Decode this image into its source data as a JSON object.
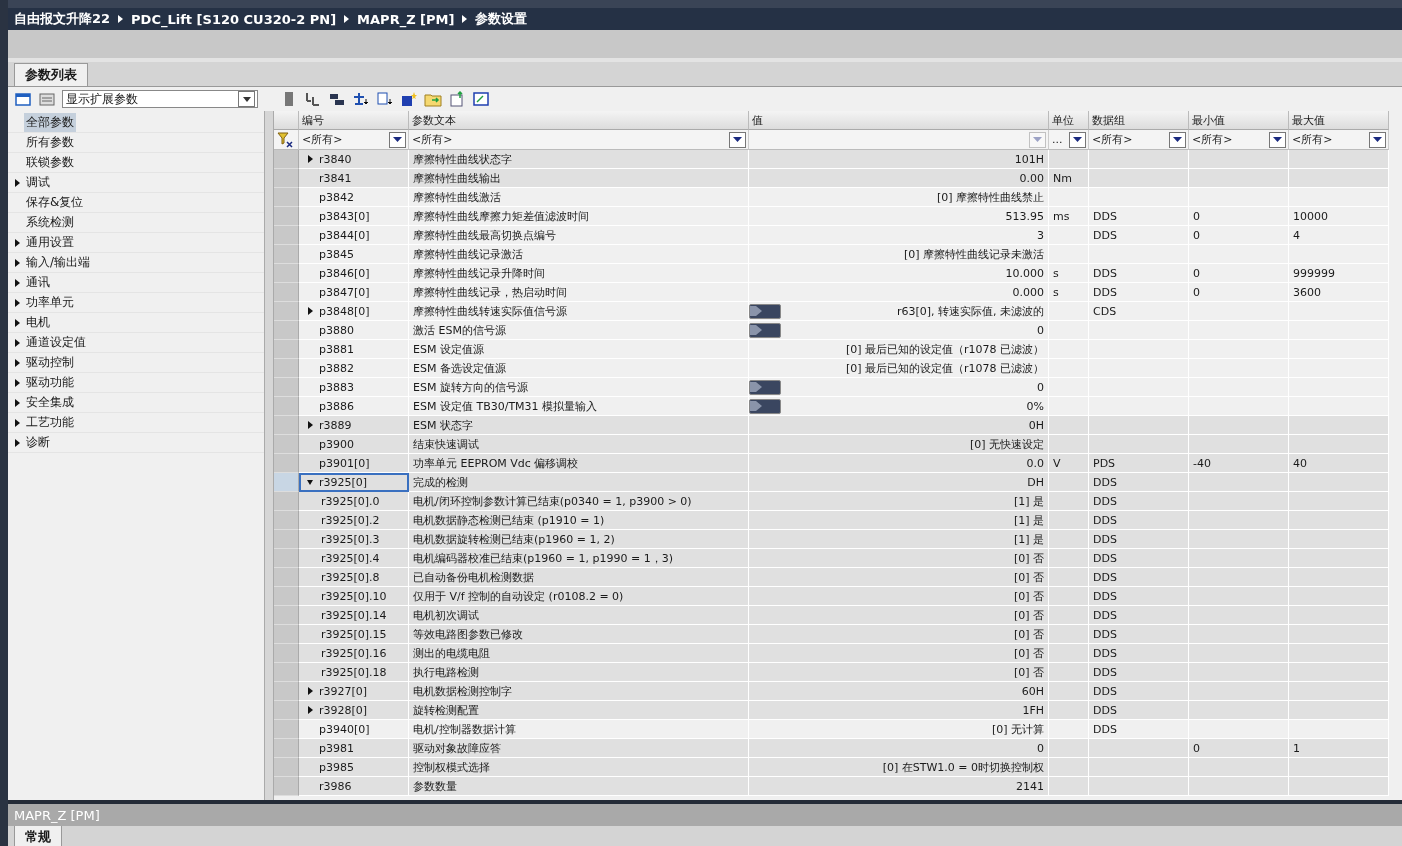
{
  "breadcrumb": [
    "自由报文升降22",
    "PDC_Lift [S120 CU320-2 PN]",
    "MAPR_Z [PM]",
    "参数设置"
  ],
  "tabs": [
    {
      "label": "参数列表",
      "selected": true
    }
  ],
  "view_select": {
    "value": "显示扩展参数"
  },
  "sidebar": {
    "items": [
      {
        "label": "全部参数",
        "selected": true,
        "expandable": false
      },
      {
        "label": "所有参数",
        "selected": false,
        "expandable": false
      },
      {
        "label": "联锁参数",
        "selected": false,
        "expandable": false
      },
      {
        "label": "调试",
        "selected": false,
        "expandable": true
      },
      {
        "label": "保存&复位",
        "selected": false,
        "expandable": false
      },
      {
        "label": "系统检测",
        "selected": false,
        "expandable": false
      },
      {
        "label": "通用设置",
        "selected": false,
        "expandable": true
      },
      {
        "label": "输入/输出端",
        "selected": false,
        "expandable": true
      },
      {
        "label": "通讯",
        "selected": false,
        "expandable": true
      },
      {
        "label": "功率单元",
        "selected": false,
        "expandable": true
      },
      {
        "label": "电机",
        "selected": false,
        "expandable": true
      },
      {
        "label": "通道设定值",
        "selected": false,
        "expandable": true
      },
      {
        "label": "驱动控制",
        "selected": false,
        "expandable": true
      },
      {
        "label": "驱动功能",
        "selected": false,
        "expandable": true
      },
      {
        "label": "安全集成",
        "selected": false,
        "expandable": true
      },
      {
        "label": "工艺功能",
        "selected": false,
        "expandable": true
      },
      {
        "label": "诊断",
        "selected": false,
        "expandable": true
      }
    ]
  },
  "table": {
    "columns": [
      "编号",
      "参数文本",
      "值",
      "单位",
      "数据组",
      "最小值",
      "最大值"
    ],
    "filters": [
      {
        "text": "<所有>",
        "disabled": false
      },
      {
        "text": "<所有>",
        "disabled": false
      },
      {
        "disabled": true
      },
      {
        "text": "...",
        "disabled": false
      },
      {
        "text": "<所有>",
        "disabled": false
      },
      {
        "text": "<所有>",
        "disabled": false
      },
      {
        "text": "<所有>",
        "disabled": false
      }
    ],
    "rows": [
      {
        "id": "r3840",
        "text": "摩擦特性曲线状态字",
        "value": "101H",
        "expandable": true,
        "expanded": false,
        "bico": false,
        "editable": false,
        "selected": false
      },
      {
        "id": "r3841",
        "text": "摩擦特性曲线输出",
        "value": "0.00",
        "unit": "Nm",
        "expandable": false,
        "expanded": false,
        "bico": false,
        "editable": false,
        "selected": false
      },
      {
        "id": "p3842",
        "text": "摩擦特性曲线激活",
        "value": "[0] 摩擦特性曲线禁止",
        "expandable": false,
        "expanded": false,
        "bico": false,
        "editable": true,
        "selected": false
      },
      {
        "id": "p3843[0]",
        "text": "摩擦特性曲线摩擦力矩差值滤波时间",
        "value": "513.95",
        "unit": "ms",
        "group": "DDS",
        "min": "0",
        "max": "10000",
        "expandable": false,
        "expanded": false,
        "bico": false,
        "editable": true,
        "selected": false
      },
      {
        "id": "p3844[0]",
        "text": "摩擦特性曲线最高切换点编号",
        "value": "3",
        "group": "DDS",
        "min": "0",
        "max": "4",
        "expandable": false,
        "expanded": false,
        "bico": false,
        "editable": true,
        "selected": false
      },
      {
        "id": "p3845",
        "text": "摩擦特性曲线记录激活",
        "value": "[0] 摩擦特性曲线记录未激活",
        "expandable": false,
        "expanded": false,
        "bico": false,
        "editable": true,
        "selected": false
      },
      {
        "id": "p3846[0]",
        "text": "摩擦特性曲线记录升降时间",
        "value": "10.000",
        "unit": "s",
        "group": "DDS",
        "min": "0",
        "max": "999999",
        "expandable": false,
        "expanded": false,
        "bico": false,
        "editable": true,
        "selected": false
      },
      {
        "id": "p3847[0]",
        "text": "摩擦特性曲线记录，热启动时间",
        "value": "0.000",
        "unit": "s",
        "group": "DDS",
        "min": "0",
        "max": "3600",
        "expandable": false,
        "expanded": false,
        "bico": false,
        "editable": true,
        "selected": false
      },
      {
        "id": "p3848[0]",
        "text": "摩擦特性曲线转速实际值信号源",
        "value": "r63[0], 转速实际值, 未滤波的",
        "group": "CDS",
        "expandable": true,
        "expanded": false,
        "bico": true,
        "editable": true,
        "selected": false
      },
      {
        "id": "p3880",
        "text": "激活 ESM的信号源",
        "value": "0",
        "expandable": false,
        "expanded": false,
        "bico": true,
        "editable": true,
        "selected": false
      },
      {
        "id": "p3881",
        "text": "ESM 设定值源",
        "value": "[0] 最后已知的设定值（r1078 已滤波）",
        "expandable": false,
        "expanded": false,
        "bico": false,
        "editable": true,
        "selected": false
      },
      {
        "id": "p3882",
        "text": "ESM 备选设定值源",
        "value": "[0] 最后已知的设定值（r1078 已滤波）",
        "expandable": false,
        "expanded": false,
        "bico": false,
        "editable": true,
        "selected": false
      },
      {
        "id": "p3883",
        "text": "ESM 旋转方向的信号源",
        "value": "0",
        "expandable": false,
        "expanded": false,
        "bico": true,
        "editable": true,
        "selected": false
      },
      {
        "id": "p3886",
        "text": "ESM 设定值 TB30/TM31 模拟量输入",
        "value": "0%",
        "expandable": false,
        "expanded": false,
        "bico": true,
        "editable": true,
        "selected": false
      },
      {
        "id": "r3889",
        "text": "ESM 状态字",
        "value": "0H",
        "expandable": true,
        "expanded": false,
        "bico": false,
        "editable": false,
        "selected": false
      },
      {
        "id": "p3900",
        "text": "结束快速调试",
        "value": "[0] 无快速设定",
        "expandable": false,
        "expanded": false,
        "bico": false,
        "editable": false,
        "selected": false
      },
      {
        "id": "p3901[0]",
        "text": "功率单元 EEPROM Vdc 偏移调校",
        "value": "0.0",
        "unit": "V",
        "group": "PDS",
        "min": "-40",
        "max": "40",
        "expandable": false,
        "expanded": false,
        "bico": false,
        "editable": false,
        "selected": false
      },
      {
        "id": "r3925[0]",
        "text": "完成的检测",
        "value": "DH",
        "group": "DDS",
        "expandable": true,
        "expanded": true,
        "bico": false,
        "editable": false,
        "selected": true,
        "children": [
          {
            "id": "r3925[0].0",
            "text": "电机/闭环控制参数计算已结束(p0340 = 1, p3900 > 0)",
            "value": "[1] 是",
            "group": "DDS",
            "selected": false
          },
          {
            "id": "r3925[0].2",
            "text": "电机数据静态检测已结束 (p1910 = 1)",
            "value": "[1] 是",
            "group": "DDS",
            "selected": false
          },
          {
            "id": "r3925[0].3",
            "text": "电机数据旋转检测已结束(p1960 = 1, 2)",
            "value": "[1] 是",
            "group": "DDS",
            "selected": false
          },
          {
            "id": "r3925[0].4",
            "text": "电机编码器校准已结束(p1960 = 1, p1990 = 1，3)",
            "value": "[0] 否",
            "group": "DDS",
            "selected": false
          },
          {
            "id": "r3925[0].8",
            "text": "已自动备份电机检测数据",
            "value": "[0] 否",
            "group": "DDS",
            "selected": false
          },
          {
            "id": "r3925[0].10",
            "text": "仅用于 V/f 控制的自动设定 (r0108.2 = 0)",
            "value": "[0] 否",
            "group": "DDS",
            "selected": false
          },
          {
            "id": "r3925[0].14",
            "text": "电机初次调试",
            "value": "[0] 否",
            "group": "DDS",
            "selected": false
          },
          {
            "id": "r3925[0].15",
            "text": "等效电路图参数已修改",
            "value": "[0] 否",
            "group": "DDS",
            "selected": false
          },
          {
            "id": "r3925[0].16",
            "text": "测出的电缆电阻",
            "value": "[0] 否",
            "group": "DDS",
            "selected": false
          },
          {
            "id": "r3925[0].18",
            "text": "执行电路检测",
            "value": "[0] 否",
            "group": "DDS",
            "selected": false
          }
        ]
      },
      {
        "id": "r3927[0]",
        "text": "电机数据检测控制字",
        "value": "60H",
        "group": "DDS",
        "expandable": true,
        "expanded": false,
        "bico": false,
        "editable": false,
        "selected": false
      },
      {
        "id": "r3928[0]",
        "text": "旋转检测配置",
        "value": "1FH",
        "group": "DDS",
        "expandable": true,
        "expanded": false,
        "bico": false,
        "editable": false,
        "selected": false
      },
      {
        "id": "p3940[0]",
        "text": "电机/控制器数据计算",
        "value": "[0] 无计算",
        "group": "DDS",
        "expandable": false,
        "expanded": false,
        "bico": false,
        "editable": true,
        "selected": false
      },
      {
        "id": "p3981",
        "text": "驱动对象故障应答",
        "value": "0",
        "min": "0",
        "max": "1",
        "expandable": false,
        "expanded": false,
        "bico": false,
        "editable": false,
        "selected": false
      },
      {
        "id": "p3985",
        "text": "控制权模式选择",
        "value": "[0] 在STW1.0 = 0时切换控制权",
        "expandable": false,
        "expanded": false,
        "bico": false,
        "editable": false,
        "selected": false
      },
      {
        "id": "r3986",
        "text": "参数数量",
        "value": "2141",
        "expandable": false,
        "expanded": false,
        "bico": false,
        "editable": false,
        "selected": false
      }
    ]
  },
  "inspector": {
    "title": "MAPR_Z [PM]",
    "tabs": [
      {
        "label": "常规",
        "selected": true
      }
    ]
  }
}
